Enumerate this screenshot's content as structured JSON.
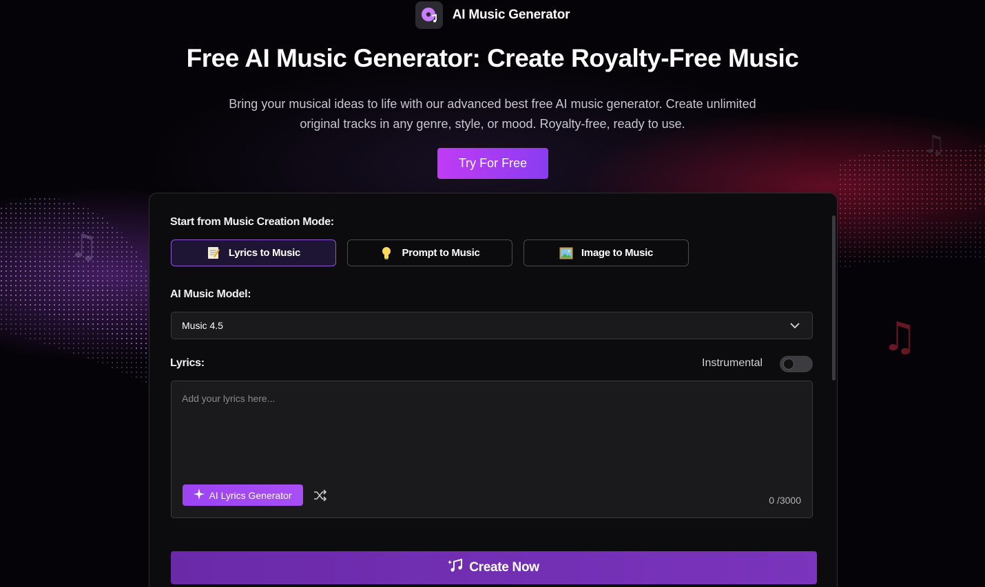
{
  "header": {
    "brand": "AI Music Generator",
    "logo_icon": "music-disc-icon"
  },
  "hero": {
    "title": "Free AI Music Generator: Create Royalty-Free Music",
    "subtitle_line1": "Bring your musical ideas to life with our advanced best free AI music generator. Create unlimited",
    "subtitle_line2": "original tracks in any genre, style, or mood. Royalty-free, ready to use.",
    "cta": "Try For Free"
  },
  "panel": {
    "mode_label": "Start from Music Creation Mode:",
    "modes": [
      {
        "label": "Lyrics to Music",
        "icon": "memo-icon",
        "active": true
      },
      {
        "label": "Prompt to Music",
        "icon": "lightbulb-icon",
        "active": false
      },
      {
        "label": "Image to Music",
        "icon": "picture-icon",
        "active": false
      }
    ],
    "model_label": "AI Music Model:",
    "model_value": "Music 4.5",
    "lyrics_label": "Lyrics:",
    "instrumental_label": "Instrumental",
    "instrumental_on": false,
    "lyrics_placeholder": "Add your lyrics here...",
    "ai_lyrics_button": "AI Lyrics Generator",
    "counter": "0 /3000",
    "create_button": "Create Now"
  },
  "colors": {
    "accent_purple": "#a34ef5",
    "create_button": "#7030b3",
    "panel_bg": "#0c0c0f"
  }
}
